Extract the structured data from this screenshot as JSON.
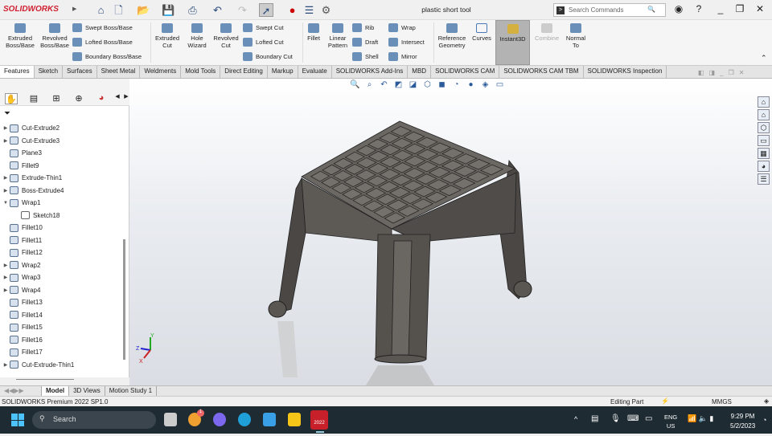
{
  "app": {
    "logo": "SOLIDWORKS",
    "document_title": "plastic short tool"
  },
  "search": {
    "placeholder": "Search Commands"
  },
  "ribbon": {
    "extruded_boss": "Extruded Boss/Base",
    "revolved_boss": "Revolved Boss/Base",
    "swept_boss": "Swept Boss/Base",
    "lofted_boss": "Lofted Boss/Base",
    "boundary_boss": "Boundary Boss/Base",
    "extruded_cut": "Extruded Cut",
    "hole_wizard": "Hole Wizard",
    "revolved_cut": "Revolved Cut",
    "swept_cut": "Swept Cut",
    "lofted_cut": "Lofted Cut",
    "boundary_cut": "Boundary Cut",
    "fillet": "Fillet",
    "linear_pattern": "Linear Pattern",
    "rib": "Rib",
    "draft": "Draft",
    "shell": "Shell",
    "wrap": "Wrap",
    "intersect": "Intersect",
    "mirror": "Mirror",
    "reference_geometry": "Reference Geometry",
    "curves": "Curves",
    "instant3d": "Instant3D",
    "combine": "Combine",
    "normal_to": "Normal To"
  },
  "tabs": [
    "Features",
    "Sketch",
    "Surfaces",
    "Sheet Metal",
    "Weldments",
    "Mold Tools",
    "Direct Editing",
    "Markup",
    "Evaluate",
    "SOLIDWORKS Add-Ins",
    "MBD",
    "SOLIDWORKS CAM",
    "SOLIDWORKS CAM TBM",
    "SOLIDWORKS Inspection"
  ],
  "tree": [
    {
      "label": "Cut-Extrude2",
      "expandable": true,
      "indent": 0
    },
    {
      "label": "Cut-Extrude3",
      "expandable": true,
      "indent": 0
    },
    {
      "label": "Plane3",
      "expandable": false,
      "indent": 0
    },
    {
      "label": "Fillet9",
      "expandable": false,
      "indent": 0
    },
    {
      "label": "Extrude-Thin1",
      "expandable": true,
      "indent": 0
    },
    {
      "label": "Boss-Extrude4",
      "expandable": true,
      "indent": 0
    },
    {
      "label": "Wrap1",
      "expandable": true,
      "expanded": true,
      "indent": 0
    },
    {
      "label": "Sketch18",
      "expandable": false,
      "indent": 1
    },
    {
      "label": "Fillet10",
      "expandable": false,
      "indent": 0
    },
    {
      "label": "Fillet11",
      "expandable": false,
      "indent": 0
    },
    {
      "label": "Fillet12",
      "expandable": false,
      "indent": 0
    },
    {
      "label": "Wrap2",
      "expandable": true,
      "indent": 0
    },
    {
      "label": "Wrap3",
      "expandable": true,
      "indent": 0
    },
    {
      "label": "Wrap4",
      "expandable": true,
      "indent": 0
    },
    {
      "label": "Fillet13",
      "expandable": false,
      "indent": 0
    },
    {
      "label": "Fillet14",
      "expandable": false,
      "indent": 0
    },
    {
      "label": "Fillet15",
      "expandable": false,
      "indent": 0
    },
    {
      "label": "Fillet16",
      "expandable": false,
      "indent": 0
    },
    {
      "label": "Fillet17",
      "expandable": false,
      "indent": 0
    },
    {
      "label": "Cut-Extrude-Thin1",
      "expandable": true,
      "indent": 0
    }
  ],
  "bottom_tabs": [
    "Model",
    "3D Views",
    "Motion Study 1"
  ],
  "status": {
    "version": "SOLIDWORKS Premium 2022 SP1.0",
    "mode": "Editing Part",
    "units": "MMGS"
  },
  "taskbar": {
    "search": "Search",
    "lang": "ENG",
    "region": "US",
    "time": "9:29 PM",
    "date": "5/2/2023",
    "badge": "1",
    "sw_label": "2022"
  },
  "triad": {
    "x": "X",
    "y": "Y",
    "z": "Z"
  },
  "colors": {
    "model": "#55514d",
    "brand_red": "#d02030",
    "taskbar": "#1f2b33",
    "instant3d_active": "#b3b3b3"
  }
}
